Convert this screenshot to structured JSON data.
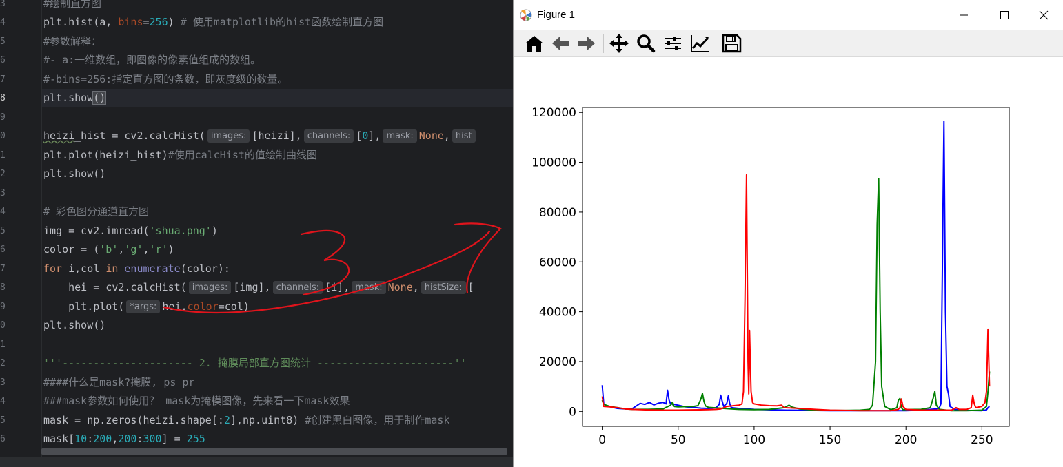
{
  "editor": {
    "gutter": [
      "3",
      "4",
      "5",
      "6",
      "7",
      "8",
      "9",
      "0",
      "1",
      "2",
      "3",
      "4",
      "5",
      "6",
      "7",
      "8",
      "9",
      "0",
      "1",
      "2",
      "3",
      "4",
      "5",
      "6"
    ],
    "lines": {
      "l3": "#绘制直方图",
      "l4_a": "plt.hist(a, ",
      "l4_b": "bins",
      "l4_c": "=",
      "l4_d": "256",
      "l4_e": ") ",
      "l4_f": "# 使用matplotlib的hist函数绘制直方图",
      "l5": "#参数解释：",
      "l6": "#- a:一维数组，即图像的像素值组成的数组。",
      "l7": "#-bins=256:指定直方图的条数，即灰度级的数量。",
      "l8_a": "plt.show",
      "l8_b": "()",
      "l10_a": "heizi",
      "l10_b": "_hist = cv2.calcHist(",
      "l10_h1": "images:",
      "l10_c": "[heizi],",
      "l10_h2": "channels:",
      "l10_d": "[",
      "l10_e": "0",
      "l10_f": "],",
      "l10_h3": "mask:",
      "l10_g": "None",
      "l10_h": ",",
      "l10_h4": "hist",
      "l11_a": "plt.plot(heizi_hist)",
      "l11_b": "#使用calcHist的值绘制曲线图",
      "l12": "plt.show()",
      "l14": "# 彩色图分通道直方图",
      "l15_a": "img = cv2.imread(",
      "l15_b": "'shua.png'",
      "l15_c": ")",
      "l16_a": "color = (",
      "l16_b": "'b'",
      "l16_c": ",",
      "l16_d": "'g'",
      "l16_e": ",",
      "l16_f": "'r'",
      "l16_g": ")",
      "l17_a": "for",
      "l17_b": " i,col ",
      "l17_c": "in",
      "l17_d": " ",
      "l17_e": "enumerate",
      "l17_f": "(color):",
      "l18_a": "    hei = cv2.calcHist(",
      "l18_h1": "images:",
      "l18_b": "[img],",
      "l18_h2": "channels:",
      "l18_c": "[i],",
      "l18_h3": "mask:",
      "l18_d": "None",
      "l18_e": ",",
      "l18_h4": "histSize:",
      "l18_f": "[",
      "l19_a": "    plt.plot(",
      "l19_h1": "*args:",
      "l19_b": "hei,",
      "l19_c": "color",
      "l19_d": "=col)",
      "l20": "plt.show()",
      "l22_a": "'''",
      "l22_b": "--------------------- 2. 掩膜局部直方图统计 ----------------------",
      "l22_c": "''",
      "l23": "####什么是mask?掩膜, ps pr",
      "l24": "###mask参数如何使用？ mask为掩模图像，先来看一下mask效果",
      "l25_a": "mask = np.zeros(heizi.shape[:",
      "l25_b": "2",
      "l25_c": "],np.uint8) ",
      "l25_d": "#创建黑白图像，用于制作mask",
      "l26_a": "mask[",
      "l26_b": "10",
      "l26_c": ":",
      "l26_d": "200",
      "l26_e": ",",
      "l26_f": "200",
      "l26_g": ":",
      "l26_h": "300",
      "l26_i": "] = ",
      "l26_j": "255"
    }
  },
  "figure": {
    "title": "Figure 1",
    "toolbar": [
      "home-icon",
      "back-arrow-icon",
      "forward-arrow-icon",
      "pan-icon",
      "zoom-icon",
      "configure-subplots-icon",
      "edit-axis-icon",
      "save-icon"
    ]
  },
  "chart_data": {
    "type": "line",
    "x_ticks": [
      0,
      50,
      100,
      150,
      200,
      250
    ],
    "y_ticks": [
      0,
      20000,
      40000,
      60000,
      80000,
      100000,
      120000
    ],
    "x_tick_labels": [
      "0",
      "50",
      "100",
      "150",
      "200",
      "250"
    ],
    "y_tick_labels": [
      "0",
      "20000",
      "40000",
      "60000",
      "80000",
      "100000",
      "120000"
    ],
    "xlim": [
      -13,
      268
    ],
    "ylim": [
      -6000,
      122000
    ],
    "series": [
      {
        "color": "#0000ff",
        "points": [
          [
            0,
            10500
          ],
          [
            1,
            3000
          ],
          [
            3,
            2200
          ],
          [
            6,
            1700
          ],
          [
            10,
            1200
          ],
          [
            15,
            1000
          ],
          [
            20,
            1200
          ],
          [
            22,
            2000
          ],
          [
            25,
            3200
          ],
          [
            28,
            2800
          ],
          [
            31,
            3600
          ],
          [
            34,
            2600
          ],
          [
            37,
            3300
          ],
          [
            40,
            3600
          ],
          [
            42,
            3000
          ],
          [
            43,
            8500
          ],
          [
            44,
            4500
          ],
          [
            45,
            3000
          ],
          [
            50,
            2500
          ],
          [
            55,
            1800
          ],
          [
            60,
            1600
          ],
          [
            65,
            1300
          ],
          [
            70,
            1200
          ],
          [
            75,
            1500
          ],
          [
            77,
            2800
          ],
          [
            78,
            6500
          ],
          [
            79,
            4000
          ],
          [
            80,
            2000
          ],
          [
            82,
            3200
          ],
          [
            83,
            6200
          ],
          [
            84,
            3000
          ],
          [
            85,
            1500
          ],
          [
            90,
            1200
          ],
          [
            100,
            800
          ],
          [
            120,
            500
          ],
          [
            150,
            300
          ],
          [
            180,
            300
          ],
          [
            200,
            300
          ],
          [
            210,
            500
          ],
          [
            220,
            1000
          ],
          [
            222,
            1500
          ],
          [
            223,
            3000
          ],
          [
            224,
            60000
          ],
          [
            225,
            116500
          ],
          [
            226,
            40000
          ],
          [
            227,
            10000
          ],
          [
            228,
            7000
          ],
          [
            229,
            2000
          ],
          [
            232,
            800
          ],
          [
            240,
            400
          ],
          [
            250,
            300
          ],
          [
            253,
            600
          ],
          [
            254,
            1500
          ],
          [
            255,
            2000
          ]
        ]
      },
      {
        "color": "#008000",
        "points": [
          [
            0,
            4500
          ],
          [
            1,
            2800
          ],
          [
            5,
            2000
          ],
          [
            10,
            1500
          ],
          [
            15,
            1000
          ],
          [
            20,
            800
          ],
          [
            30,
            800
          ],
          [
            40,
            1000
          ],
          [
            45,
            2500
          ],
          [
            46,
            3500
          ],
          [
            47,
            2000
          ],
          [
            50,
            1800
          ],
          [
            55,
            1900
          ],
          [
            60,
            2000
          ],
          [
            63,
            2300
          ],
          [
            65,
            5000
          ],
          [
            66,
            7200
          ],
          [
            67,
            4000
          ],
          [
            68,
            2200
          ],
          [
            70,
            1600
          ],
          [
            75,
            1400
          ],
          [
            80,
            1200
          ],
          [
            85,
            1000
          ],
          [
            90,
            800
          ],
          [
            100,
            700
          ],
          [
            110,
            800
          ],
          [
            120,
            1500
          ],
          [
            123,
            2500
          ],
          [
            125,
            1700
          ],
          [
            130,
            1000
          ],
          [
            140,
            500
          ],
          [
            150,
            400
          ],
          [
            160,
            400
          ],
          [
            170,
            500
          ],
          [
            176,
            800
          ],
          [
            178,
            2500
          ],
          [
            180,
            20000
          ],
          [
            181,
            75000
          ],
          [
            182,
            93500
          ],
          [
            183,
            40000
          ],
          [
            184,
            10000
          ],
          [
            186,
            2000
          ],
          [
            190,
            700
          ],
          [
            194,
            1500
          ],
          [
            195,
            4500
          ],
          [
            196,
            5200
          ],
          [
            197,
            1500
          ],
          [
            198,
            700
          ],
          [
            210,
            800
          ],
          [
            216,
            1500
          ],
          [
            218,
            5500
          ],
          [
            219,
            8000
          ],
          [
            220,
            2500
          ],
          [
            222,
            800
          ],
          [
            230,
            300
          ],
          [
            240,
            300
          ],
          [
            250,
            500
          ],
          [
            253,
            2000
          ],
          [
            254,
            8000
          ],
          [
            255,
            16000
          ]
        ]
      },
      {
        "color": "#ff0000",
        "points": [
          [
            0,
            6000
          ],
          [
            1,
            2000
          ],
          [
            5,
            1800
          ],
          [
            10,
            1500
          ],
          [
            15,
            1000
          ],
          [
            20,
            800
          ],
          [
            30,
            600
          ],
          [
            40,
            500
          ],
          [
            50,
            500
          ],
          [
            60,
            600
          ],
          [
            70,
            700
          ],
          [
            75,
            800
          ],
          [
            78,
            1000
          ],
          [
            80,
            1500
          ],
          [
            82,
            2000
          ],
          [
            90,
            2500
          ],
          [
            92,
            3000
          ],
          [
            93,
            8000
          ],
          [
            94,
            45000
          ],
          [
            95,
            95000
          ],
          [
            96,
            20000
          ],
          [
            96.5,
            7000
          ],
          [
            97,
            32500
          ],
          [
            98,
            8000
          ],
          [
            99,
            3500
          ],
          [
            100,
            3000
          ],
          [
            105,
            2500
          ],
          [
            110,
            2300
          ],
          [
            115,
            2200
          ],
          [
            118,
            2500
          ],
          [
            120,
            1500
          ],
          [
            130,
            1200
          ],
          [
            140,
            800
          ],
          [
            150,
            500
          ],
          [
            160,
            400
          ],
          [
            170,
            300
          ],
          [
            180,
            300
          ],
          [
            190,
            300
          ],
          [
            195,
            800
          ],
          [
            196,
            1500
          ],
          [
            197,
            5000
          ],
          [
            198,
            2000
          ],
          [
            200,
            800
          ],
          [
            210,
            500
          ],
          [
            220,
            500
          ],
          [
            230,
            500
          ],
          [
            233,
            1500
          ],
          [
            235,
            800
          ],
          [
            240,
            800
          ],
          [
            243,
            1500
          ],
          [
            244,
            6500
          ],
          [
            245,
            3000
          ],
          [
            246,
            1500
          ],
          [
            250,
            2000
          ],
          [
            252,
            3500
          ],
          [
            253,
            8000
          ],
          [
            254,
            33000
          ],
          [
            255,
            10000
          ]
        ]
      }
    ]
  }
}
